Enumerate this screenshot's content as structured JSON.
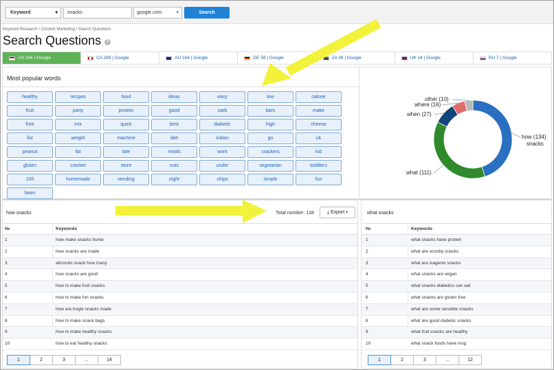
{
  "toolbar": {
    "type_select": "Keyword",
    "search_value": "snacks",
    "database_select": "google.com",
    "search_button": "Search"
  },
  "breadcrumb": "Keyword Research / Content Marketing / Search Questions",
  "page_title": "Search Questions",
  "help_icon": "?",
  "databases": [
    {
      "label": "US 294 | Google",
      "flag": "us-flag-icon",
      "active": true
    },
    {
      "label": "CA 289 | Google",
      "flag": "ca-flag-icon"
    },
    {
      "label": "AU 164 | Google",
      "flag": "au-flag-icon"
    },
    {
      "label": "DE 58 | Google",
      "flag": "de-flag-icon"
    },
    {
      "label": "ZA 36 | Google",
      "flag": "za-flag-icon"
    },
    {
      "label": "UK 24 | Google",
      "flag": "uk-flag-icon"
    },
    {
      "label": "RU 7 | Google",
      "flag": "ru-flag-icon"
    }
  ],
  "popular_words": {
    "title": "Most popular words",
    "words": [
      "healthy",
      "recipes",
      "food",
      "ideas",
      "easy",
      "low",
      "calorie",
      "fruit",
      "party",
      "protein",
      "good",
      "carb",
      "bars",
      "make",
      "free",
      "mix",
      "quick",
      "best",
      "diabetic",
      "high",
      "cheese",
      "list",
      "weight",
      "machine",
      "diet",
      "indian",
      "go",
      "uk",
      "peanut",
      "fat",
      "late",
      "meals",
      "work",
      "crackers",
      "kid",
      "gluten",
      "cracker",
      "store",
      "nuts",
      "under",
      "vegetarian",
      "toddlers",
      "100",
      "homemade",
      "vending",
      "night",
      "chips",
      "simple",
      "fun",
      "bean"
    ]
  },
  "chart_data": {
    "type": "pie",
    "donut": true,
    "categories": [
      "how",
      "what",
      "when",
      "where",
      "other"
    ],
    "values": [
      134,
      111,
      27,
      16,
      10
    ],
    "labels": [
      "how (134)",
      "what (111)",
      "when (27)",
      "where (16)",
      "other (10)"
    ],
    "colors": [
      "#2a6fc0",
      "#2e8a2a",
      "#14457a",
      "#e06b6b",
      "#b9b9b9"
    ],
    "annotations": [
      "snacks"
    ]
  },
  "left_table": {
    "title": "how snacks",
    "total_label": "Total number: 134",
    "export_label": "Export",
    "col_num": "№",
    "col_keywords": "Keywords",
    "rows": [
      [
        "1",
        "how make snacks home"
      ],
      [
        "2",
        "how snacks are made"
      ],
      [
        "3",
        "almonds snack how many"
      ],
      [
        "4",
        "how snacks are good"
      ],
      [
        "5",
        "how to make fruit snacks"
      ],
      [
        "6",
        "how to make fun snacks"
      ],
      [
        "7",
        "how are bugle snacks made"
      ],
      [
        "8",
        "how to make snack bags"
      ],
      [
        "9",
        "how to make healthy snacks"
      ],
      [
        "10",
        "how to eat healthy snacks"
      ]
    ],
    "pages": [
      "1",
      "2",
      "3",
      "...",
      "14"
    ]
  },
  "right_table": {
    "title": "what snacks",
    "col_num": "№",
    "col_keywords": "Keywords",
    "rows": [
      [
        "1",
        "what snacks have protein"
      ],
      [
        "2",
        "what are scooby snacks"
      ],
      [
        "3",
        "what are isagenix snacks"
      ],
      [
        "4",
        "what snacks are vegan"
      ],
      [
        "5",
        "what snacks diabetics can eat"
      ],
      [
        "6",
        "what snacks are gluten free"
      ],
      [
        "7",
        "what are some sensible snacks"
      ],
      [
        "8",
        "what are good diabetic snacks"
      ],
      [
        "9",
        "what fruit snacks are healthy"
      ],
      [
        "10",
        "what snack foods have msg"
      ]
    ],
    "pages": [
      "1",
      "2",
      "3",
      "...",
      "12"
    ]
  },
  "annotation_color": "#f2f23a"
}
